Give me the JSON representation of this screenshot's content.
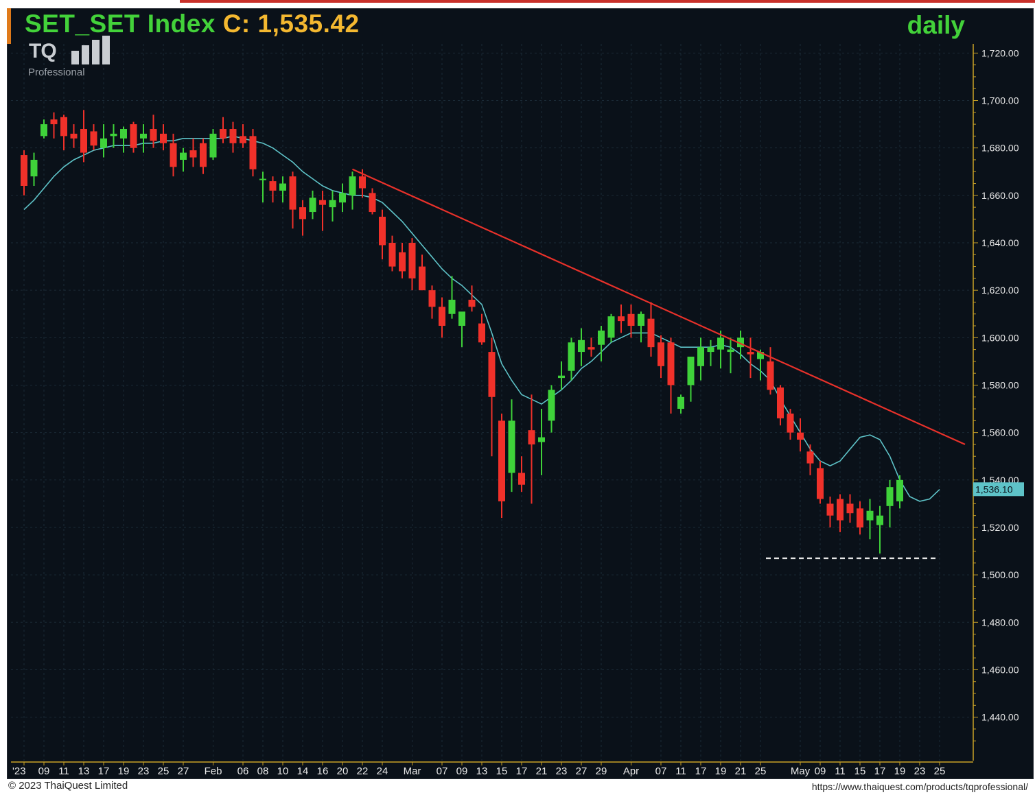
{
  "header": {
    "symbol_label": "SET_SET Index",
    "close_label": "C: 1,535.42",
    "period": "daily"
  },
  "logo": {
    "brand": "TQ",
    "sub": "Professional"
  },
  "footer": {
    "copyright": "© 2023 ThaiQuest Limited",
    "url": "https://www.thaiquest.com/products/tqprofessional/"
  },
  "colors": {
    "up": "#3fd23a",
    "down": "#f0312a",
    "ma": "#5ec3c8",
    "trendline": "#e8312a",
    "support": "#e6e6e6",
    "background": "#0a1119",
    "grid": "#1a2a36"
  },
  "chart_data": {
    "type": "candlestick",
    "period": "daily",
    "ylim": [
      1420,
      1725
    ],
    "yticks": [
      1440,
      1460,
      1480,
      1500,
      1520,
      1540,
      1560,
      1580,
      1600,
      1620,
      1640,
      1660,
      1680,
      1700,
      1720
    ],
    "ytick_labels": [
      "1,440.00",
      "1,460.00",
      "1,480.00",
      "1,500.00",
      "1,520.00",
      "1,540.00",
      "1,560.00",
      "1,580.00",
      "1,600.00",
      "1,620.00",
      "1,640.00",
      "1,660.00",
      "1,680.00",
      "1,700.00",
      "1,720.00"
    ],
    "xtick_labels": [
      {
        "i": 0,
        "label": "'23"
      },
      {
        "i": 2,
        "label": "09"
      },
      {
        "i": 4,
        "label": "11"
      },
      {
        "i": 6,
        "label": "13"
      },
      {
        "i": 8,
        "label": "17"
      },
      {
        "i": 10,
        "label": "19"
      },
      {
        "i": 12,
        "label": "23"
      },
      {
        "i": 14,
        "label": "25"
      },
      {
        "i": 16,
        "label": "27"
      },
      {
        "i": 19,
        "label": "Feb"
      },
      {
        "i": 22,
        "label": "06"
      },
      {
        "i": 24,
        "label": "08"
      },
      {
        "i": 26,
        "label": "10"
      },
      {
        "i": 28,
        "label": "14"
      },
      {
        "i": 30,
        "label": "16"
      },
      {
        "i": 32,
        "label": "20"
      },
      {
        "i": 34,
        "label": "22"
      },
      {
        "i": 36,
        "label": "24"
      },
      {
        "i": 39,
        "label": "Mar"
      },
      {
        "i": 42,
        "label": "07"
      },
      {
        "i": 44,
        "label": "09"
      },
      {
        "i": 46,
        "label": "13"
      },
      {
        "i": 48,
        "label": "15"
      },
      {
        "i": 50,
        "label": "17"
      },
      {
        "i": 52,
        "label": "21"
      },
      {
        "i": 54,
        "label": "23"
      },
      {
        "i": 56,
        "label": "27"
      },
      {
        "i": 58,
        "label": "29"
      },
      {
        "i": 61,
        "label": "Apr"
      },
      {
        "i": 64,
        "label": "07"
      },
      {
        "i": 66,
        "label": "11"
      },
      {
        "i": 68,
        "label": "17"
      },
      {
        "i": 70,
        "label": "19"
      },
      {
        "i": 72,
        "label": "21"
      },
      {
        "i": 74,
        "label": "25"
      },
      {
        "i": 78,
        "label": "May"
      },
      {
        "i": 80,
        "label": "09"
      },
      {
        "i": 82,
        "label": "11"
      },
      {
        "i": 84,
        "label": "15"
      },
      {
        "i": 86,
        "label": "17"
      },
      {
        "i": 88,
        "label": "19"
      },
      {
        "i": 90,
        "label": "23"
      },
      {
        "i": 92,
        "label": "25"
      }
    ],
    "last_price_label": "1,536.10",
    "last_price": 1536.1,
    "ohlc": [
      [
        1677,
        1679,
        1660,
        1664
      ],
      [
        1668,
        1678,
        1664,
        1675
      ],
      [
        1685,
        1692,
        1684,
        1690
      ],
      [
        1692,
        1695,
        1684,
        1690
      ],
      [
        1693,
        1694,
        1679,
        1685
      ],
      [
        1686,
        1690,
        1680,
        1684
      ],
      [
        1688,
        1696,
        1674,
        1678
      ],
      [
        1687,
        1690,
        1679,
        1681
      ],
      [
        1680,
        1690,
        1676,
        1684
      ],
      [
        1685,
        1690,
        1680,
        1686
      ],
      [
        1684,
        1689,
        1678,
        1688
      ],
      [
        1690,
        1691,
        1678,
        1680
      ],
      [
        1684,
        1690,
        1678,
        1686
      ],
      [
        1688,
        1694,
        1680,
        1683
      ],
      [
        1686,
        1690,
        1679,
        1682
      ],
      [
        1682,
        1686,
        1668,
        1672
      ],
      [
        1675,
        1680,
        1670,
        1678
      ],
      [
        1679,
        1684,
        1672,
        1676
      ],
      [
        1682,
        1684,
        1669,
        1672
      ],
      [
        1676,
        1688,
        1675,
        1686
      ],
      [
        1688,
        1693,
        1682,
        1684
      ],
      [
        1688,
        1691,
        1678,
        1682
      ],
      [
        1685,
        1690,
        1680,
        1682
      ],
      [
        1685,
        1688,
        1668,
        1671
      ],
      [
        1667,
        1670,
        1657,
        1667
      ],
      [
        1666,
        1668,
        1657,
        1662
      ],
      [
        1662,
        1668,
        1657,
        1665
      ],
      [
        1668,
        1670,
        1646,
        1654
      ],
      [
        1655,
        1658,
        1643,
        1650
      ],
      [
        1653,
        1662,
        1650,
        1659
      ],
      [
        1658,
        1662,
        1645,
        1656
      ],
      [
        1655,
        1662,
        1649,
        1658
      ],
      [
        1657,
        1665,
        1653,
        1661
      ],
      [
        1660,
        1670,
        1654,
        1668
      ],
      [
        1668,
        1671,
        1659,
        1663
      ],
      [
        1661,
        1663,
        1652,
        1653
      ],
      [
        1651,
        1654,
        1633,
        1639
      ],
      [
        1640,
        1643,
        1628,
        1630
      ],
      [
        1636,
        1640,
        1625,
        1628
      ],
      [
        1640,
        1642,
        1620,
        1625
      ],
      [
        1630,
        1635,
        1620,
        1620
      ],
      [
        1620,
        1622,
        1608,
        1613
      ],
      [
        1613,
        1617,
        1600,
        1605
      ],
      [
        1610,
        1626,
        1608,
        1616
      ],
      [
        1605,
        1610,
        1596,
        1611
      ],
      [
        1616,
        1622,
        1611,
        1613
      ],
      [
        1606,
        1610,
        1597,
        1598
      ],
      [
        1594,
        1600,
        1550,
        1575
      ],
      [
        1565,
        1568,
        1524,
        1531
      ],
      [
        1543,
        1574,
        1535,
        1565
      ],
      [
        1543,
        1550,
        1535,
        1538
      ],
      [
        1561,
        1576,
        1530,
        1555
      ],
      [
        1556,
        1570,
        1542,
        1558
      ],
      [
        1565,
        1580,
        1560,
        1578
      ],
      [
        1583,
        1590,
        1578,
        1584
      ],
      [
        1586,
        1600,
        1582,
        1598
      ],
      [
        1594,
        1604,
        1588,
        1599
      ],
      [
        1596,
        1600,
        1592,
        1595
      ],
      [
        1597,
        1605,
        1590,
        1603
      ],
      [
        1600,
        1610,
        1598,
        1609
      ],
      [
        1609,
        1614,
        1602,
        1607
      ],
      [
        1610,
        1614,
        1600,
        1605
      ],
      [
        1605,
        1611,
        1598,
        1610
      ],
      [
        1608,
        1615,
        1592,
        1596
      ],
      [
        1598,
        1601,
        1583,
        1588
      ],
      [
        1598,
        1600,
        1568,
        1580
      ],
      [
        1570,
        1576,
        1568,
        1575
      ],
      [
        1580,
        1588,
        1573,
        1592
      ],
      [
        1588,
        1600,
        1582,
        1596
      ],
      [
        1594,
        1599,
        1588,
        1596
      ],
      [
        1595,
        1603,
        1587,
        1600
      ],
      [
        1594,
        1600,
        1585,
        1595
      ],
      [
        1596,
        1603,
        1591,
        1600
      ],
      [
        1594,
        1600,
        1583,
        1593
      ],
      [
        1591,
        1595,
        1582,
        1594
      ],
      [
        1590,
        1596,
        1576,
        1578
      ],
      [
        1579,
        1580,
        1563,
        1566
      ],
      [
        1568,
        1570,
        1557,
        1560
      ],
      [
        1560,
        1566,
        1552,
        1557
      ],
      [
        1552,
        1555,
        1542,
        1547
      ],
      [
        1545,
        1548,
        1530,
        1532
      ],
      [
        1530,
        1533,
        1520,
        1525
      ],
      [
        1532,
        1534,
        1518,
        1523
      ],
      [
        1530,
        1534,
        1522,
        1526
      ],
      [
        1528,
        1531,
        1517,
        1520
      ],
      [
        1523,
        1532,
        1515,
        1527
      ],
      [
        1521,
        1529,
        1509,
        1525
      ],
      [
        1529,
        1540,
        1520,
        1537
      ],
      [
        1531,
        1542,
        1528,
        1540
      ]
    ],
    "ma_values": [
      1654,
      1658,
      1663,
      1668,
      1672,
      1675,
      1677,
      1679,
      1680,
      1681,
      1681,
      1681,
      1682,
      1682,
      1683,
      1683,
      1684,
      1684,
      1684,
      1684,
      1684,
      1685,
      1684,
      1683,
      1682,
      1680,
      1677,
      1674,
      1670,
      1667,
      1664,
      1662,
      1661,
      1660,
      1660,
      1659,
      1657,
      1653,
      1649,
      1644,
      1639,
      1634,
      1629,
      1625,
      1622,
      1618,
      1614,
      1602,
      1589,
      1582,
      1576,
      1574,
      1572,
      1575,
      1578,
      1582,
      1587,
      1590,
      1594,
      1598,
      1600,
      1602,
      1602,
      1602,
      1600,
      1598,
      1596,
      1596,
      1596,
      1596,
      1597,
      1596,
      1593,
      1589,
      1586,
      1582,
      1574,
      1567,
      1560,
      1553,
      1548,
      1546,
      1548,
      1553,
      1558,
      1559,
      1557,
      1550,
      1540,
      1533,
      1531,
      1532,
      1536
    ],
    "trendline": [
      [
        1651.6,
        1671
      ],
      [
        1547.4,
        1555
      ]
    ],
    "support_level": 1507,
    "support_range": [
      1506,
      1627
    ]
  }
}
